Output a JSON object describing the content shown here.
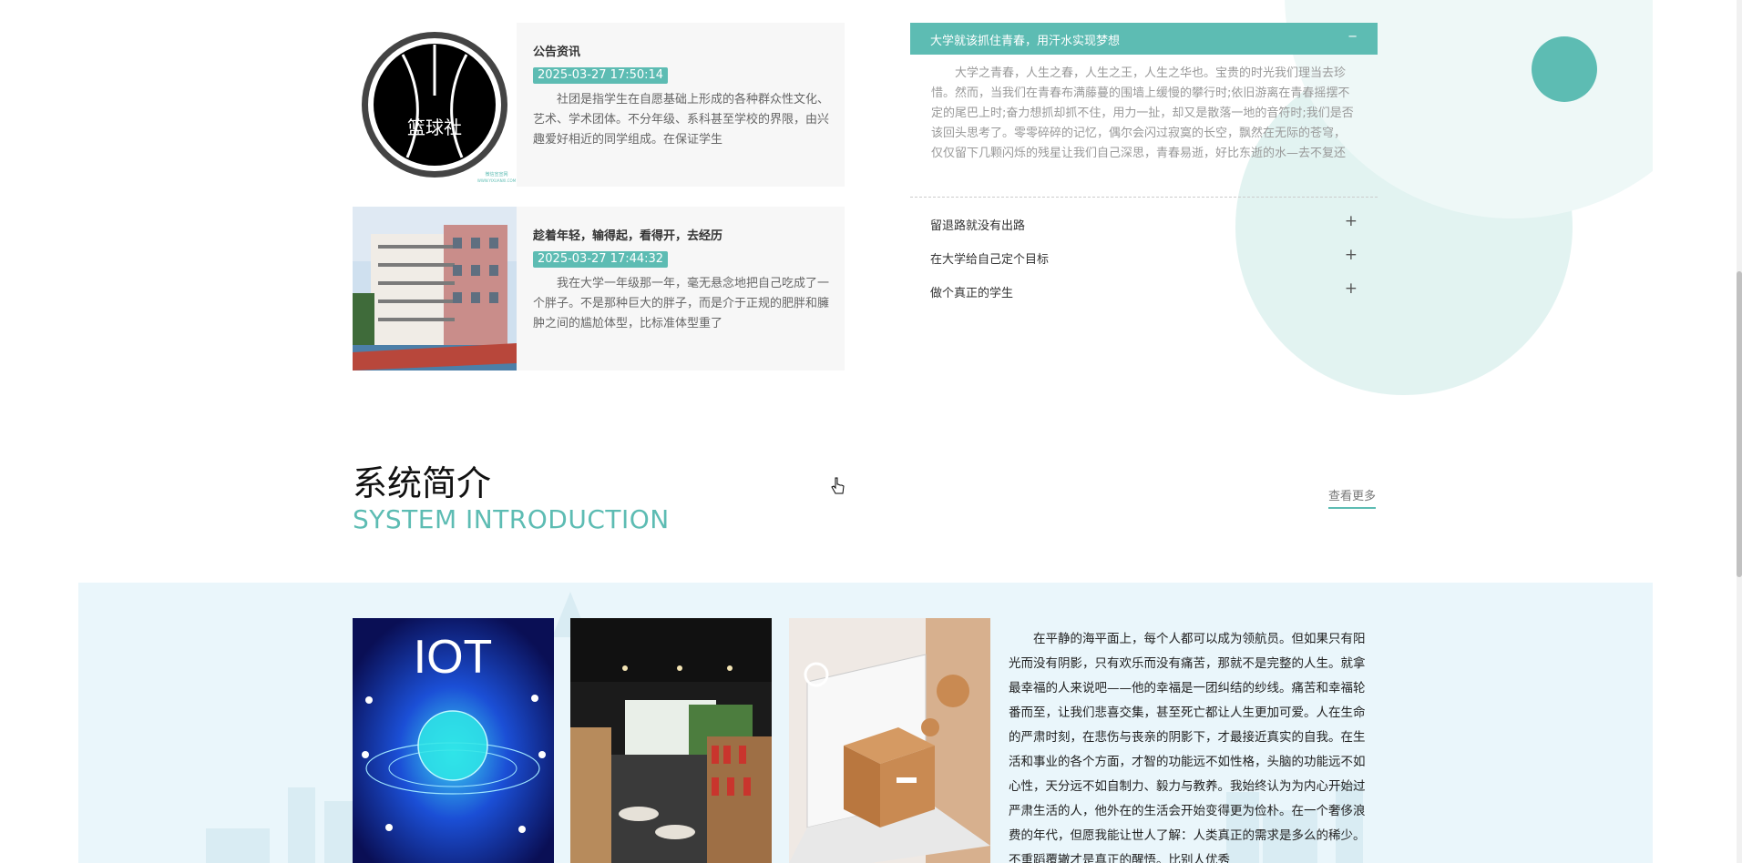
{
  "colors": {
    "accent": "#5dbcb3",
    "band": "#eaf6fb",
    "card": "#f7f7f7"
  },
  "news": [
    {
      "title": "公告资讯",
      "date": "2025-03-27 17:50:14",
      "desc": "社团是指学生在自愿基础上形成的各种群众性文化、艺术、学术团体。不分年级、系科甚至学校的界限，由兴趣爱好相近的同学组成。在保证学生",
      "logo_text": "篮球社",
      "logo_caption": "微信宣宣网",
      "logo_url": "WWW.YIXUANXI.COM"
    },
    {
      "title": "趁着年轻，输得起，看得开，去经历",
      "date": "2025-03-27 17:44:32",
      "desc": "我在大学一年级那一年，毫无悬念地把自己吃成了一个胖子。不是那种巨大的胖子，而是介于正规的肥胖和臃肿之间的尴尬体型，比标准体型重了"
    }
  ],
  "accordion": {
    "active_title": "大学就该抓住青春，用汗水实现梦想",
    "active_symbol": "−",
    "active_body": "大学之青春，人生之春，人生之王，人生之华也。宝贵的时光我们理当去珍惜。然而，当我们在青春布满藤蔓的围墙上缓慢的攀行时;依旧游离在青春摇摆不定的尾巴上时;奋力想抓却抓不住，用力一扯，却又是散落一地的音符时;我们是否该回头思考了。零零碎碎的记忆，偶尔会闪过寂寞的长空，飘然在无际的苍穹，仅仅留下几颗闪烁的残星让我们自己深思，青春易逝，好比东逝的水—去不复还",
    "items": [
      {
        "label": "留退路就没有出路",
        "symbol": "+"
      },
      {
        "label": "在大学给自己定个目标",
        "symbol": "+"
      },
      {
        "label": "做个真正的学生",
        "symbol": "+"
      }
    ]
  },
  "intro": {
    "title": "系统简介",
    "subtitle": "SYSTEM INTRODUCTION",
    "more": "查看更多",
    "iot_label": "IOT",
    "text": "在平静的海平面上，每个人都可以成为领航员。但如果只有阳光而没有阴影，只有欢乐而没有痛苦，那就不是完整的人生。就拿最幸福的人来说吧——他的幸福是一团纠结的纱线。痛苦和幸福轮番而至，让我们悲喜交集，甚至死亡都让人生更加可爱。人在生命的严肃时刻，在悲伤与丧亲的阴影下，才最接近真实的自我。在生活和事业的各个方面，才智的功能远不如性格，头脑的功能远不如心性，天分远不如自制力、毅力与教养。我始终认为为内心开始过严肃生活的人，他外在的生活会开始变得更为俭朴。在一个奢侈浪费的年代，但愿我能让世人了解：人类真正的需求是多么的稀少。不重蹈覆辙才是真正的醒悟。比别人优秀"
  }
}
